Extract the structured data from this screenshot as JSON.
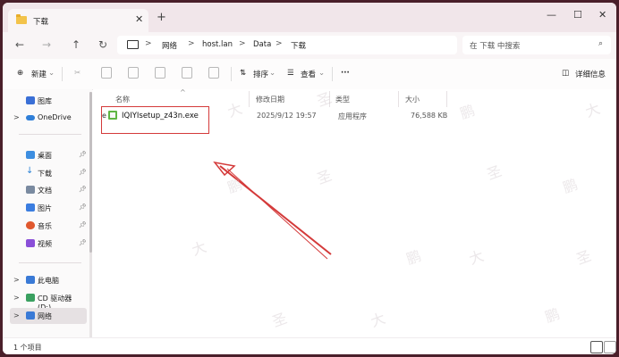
{
  "window": {
    "tab_title": "下载",
    "tab_close": "✕",
    "new_tab": "+",
    "minimize": "—",
    "maximize": "☐",
    "close": "✕"
  },
  "nav": {
    "back": "←",
    "forward": "→",
    "up": "↑",
    "refresh": "↻",
    "breadcrumb": [
      "网络",
      "host.lan",
      "Data",
      "下载"
    ],
    "separator": ">",
    "search_placeholder": "在 下载 中搜索"
  },
  "toolbar": {
    "new_label": "新建",
    "sort_label": "排序",
    "view_label": "查看",
    "more_label": "···",
    "details_label": "详细信息"
  },
  "sidebar": {
    "items": [
      {
        "label": "图库",
        "icon": "gallery-icon",
        "color": "#3a6fd6"
      },
      {
        "label": "OneDrive",
        "icon": "cloud-icon",
        "color": "#2f7fd8"
      },
      {
        "label": "桌面",
        "icon": "desktop-icon",
        "color": "#3d8ee0"
      },
      {
        "label": "下载",
        "icon": "download-icon",
        "color": "#2e84d6"
      },
      {
        "label": "文档",
        "icon": "document-icon",
        "color": "#7a8aa0"
      },
      {
        "label": "图片",
        "icon": "pictures-icon",
        "color": "#3b7de0"
      },
      {
        "label": "音乐",
        "icon": "music-icon",
        "color": "#e0582e"
      },
      {
        "label": "视频",
        "icon": "video-icon",
        "color": "#8a4fd8"
      },
      {
        "label": "此电脑",
        "icon": "computer-icon",
        "color": "#3a7ad6"
      },
      {
        "label": "CD 驱动器 (D:)",
        "icon": "cd-drive-icon",
        "color": "#3aa060"
      },
      {
        "label": "网络",
        "icon": "network-icon",
        "color": "#3a7ad6"
      }
    ]
  },
  "columns": {
    "name": "名称",
    "modified": "修改日期",
    "type": "类型",
    "size": "大小"
  },
  "files": [
    {
      "prefix": "e",
      "name": "IQIYIsetup_z43n.exe",
      "modified": "2025/9/12 19:57",
      "type": "应用程序",
      "size": "76,588 KB"
    }
  ],
  "status": {
    "count": "1 个项目"
  },
  "watermark": [
    "鹏",
    "大",
    "圣"
  ],
  "colors": {
    "highlight_box": "#d43a3a",
    "arrow": "#d43a3a"
  }
}
